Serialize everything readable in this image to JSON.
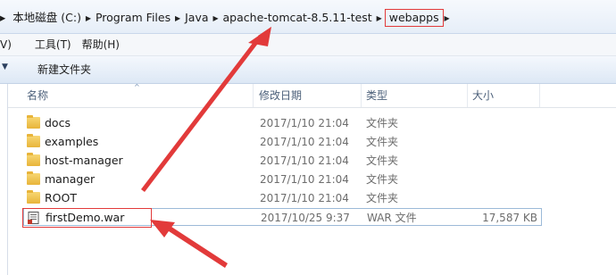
{
  "address_bar": {
    "lead": "▸",
    "crumbs": [
      "本地磁盘 (C:)",
      "Program Files",
      "Java",
      "apache-tomcat-8.5.11-test",
      "webapps"
    ],
    "separator": "▶"
  },
  "menubar": {
    "items": [
      "V)",
      "工具(T)",
      "帮助(H)"
    ]
  },
  "command_bar": {
    "chevron": "▼",
    "new_folder_label": "新建文件夹"
  },
  "list": {
    "columns": {
      "name": "名称",
      "modified": "修改日期",
      "type": "类型",
      "size": "大小"
    },
    "sort_indicator": "^",
    "rows": [
      {
        "name": "docs",
        "modified": "2017/1/10 21:04",
        "type": "文件夹",
        "size": "",
        "icon": "folder-icon"
      },
      {
        "name": "examples",
        "modified": "2017/1/10 21:04",
        "type": "文件夹",
        "size": "",
        "icon": "folder-icon"
      },
      {
        "name": "host-manager",
        "modified": "2017/1/10 21:04",
        "type": "文件夹",
        "size": "",
        "icon": "folder-icon"
      },
      {
        "name": "manager",
        "modified": "2017/1/10 21:04",
        "type": "文件夹",
        "size": "",
        "icon": "folder-icon"
      },
      {
        "name": "ROOT",
        "modified": "2017/1/10 21:04",
        "type": "文件夹",
        "size": "",
        "icon": "folder-icon"
      },
      {
        "name": "firstDemo.war",
        "modified": "2017/10/25 9:37",
        "type": "WAR 文件",
        "size": "17,587 KB",
        "icon": "war-file-icon"
      }
    ]
  },
  "colors": {
    "highlight": "#e23a3a",
    "folder": "#e8b43a",
    "selection_border": "#9cbad8"
  }
}
